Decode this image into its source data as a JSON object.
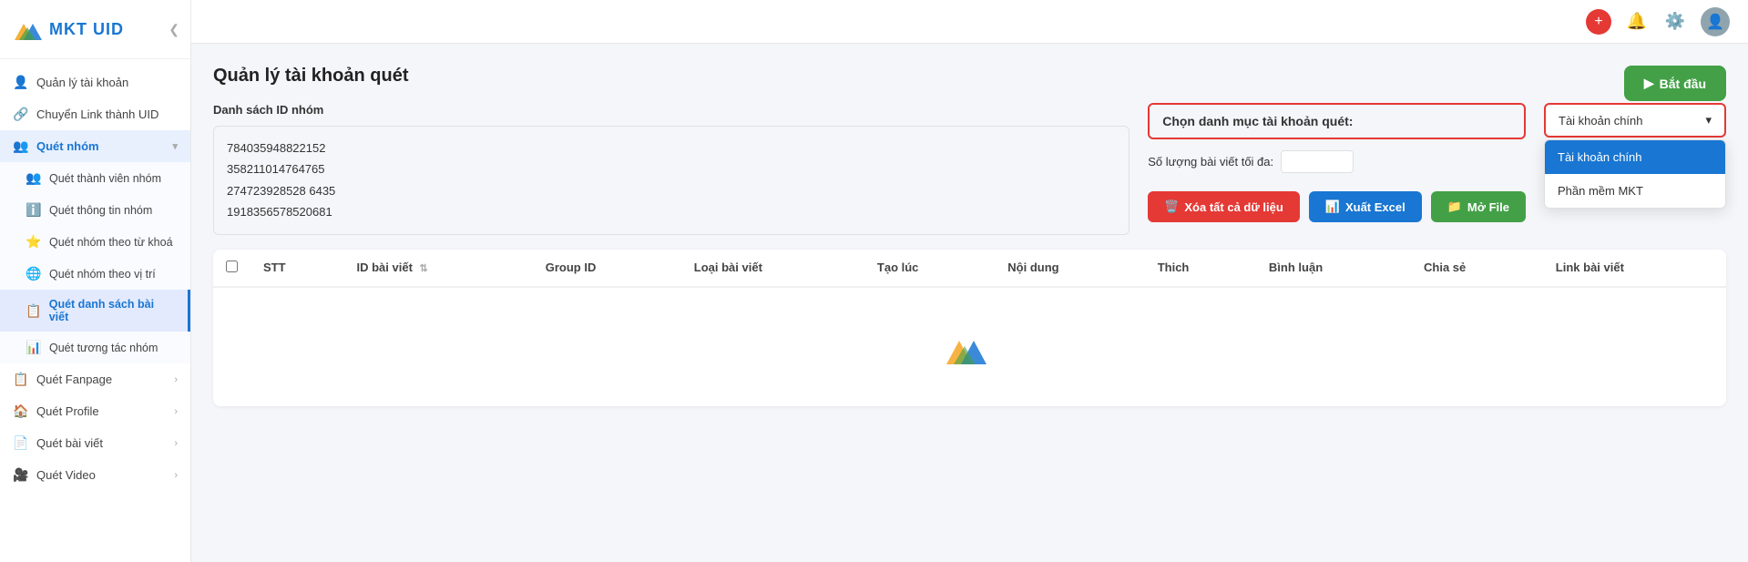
{
  "app": {
    "name": "MKT UID",
    "collapse_icon": "❮"
  },
  "sidebar": {
    "items": [
      {
        "id": "quan-ly-tai-khoan",
        "label": "Quản lý tài khoản",
        "icon": "👤",
        "hasChildren": false
      },
      {
        "id": "chuyen-link-uid",
        "label": "Chuyển Link thành UID",
        "icon": "🔗",
        "hasChildren": false
      },
      {
        "id": "quet-nhom",
        "label": "Quét nhóm",
        "icon": "👥",
        "hasChildren": true,
        "expanded": true
      },
      {
        "id": "quet-fanpage",
        "label": "Quét Fanpage",
        "icon": "📋",
        "hasChildren": true
      },
      {
        "id": "quet-profile",
        "label": "Quét Profile",
        "icon": "🏠",
        "hasChildren": true
      },
      {
        "id": "quet-bai-viet",
        "label": "Quét bài viết",
        "icon": "📄",
        "hasChildren": true
      },
      {
        "id": "quet-video",
        "label": "Quét Video",
        "icon": "🎥",
        "hasChildren": true
      }
    ],
    "sub_items": [
      {
        "id": "quet-thanh-vien-nhom",
        "label": "Quét thành viên nhóm",
        "icon": "👥"
      },
      {
        "id": "quet-thong-tin-nhom",
        "label": "Quét thông tin nhóm",
        "icon": "ℹ️"
      },
      {
        "id": "quet-nhom-tu-khoa",
        "label": "Quét nhóm theo từ khoá",
        "icon": "⭐"
      },
      {
        "id": "quet-nhom-vi-tri",
        "label": "Quét nhóm theo vị trí",
        "icon": "🌐"
      },
      {
        "id": "quet-danh-sach-bai-viet",
        "label": "Quét danh sách bài viết",
        "icon": "📋",
        "active": true
      },
      {
        "id": "quet-tuong-tac-nhom",
        "label": "Quét tương tác nhóm",
        "icon": "📊"
      }
    ]
  },
  "topbar": {
    "notification_icon": "🔔",
    "settings_icon": "⚙️",
    "avatar_icon": "👤",
    "plus_icon": "+"
  },
  "page": {
    "title": "Quản lý tài khoản quét",
    "section_label": "Danh sách ID nhóm",
    "group_ids": [
      "784035948822152",
      "358211014764765",
      "274723928528 6435",
      "1918356578520681"
    ],
    "select_label": "Chọn danh mục tài khoản quét:",
    "max_posts_label": "Số lượng bài viết tối đa:",
    "dropdown_value": "Tài khoản chính",
    "dropdown_options": [
      {
        "id": "tai-khoan-chinh",
        "label": "Tài khoản chính",
        "selected": true
      },
      {
        "id": "phan-mem-mkt",
        "label": "Phần mềm MKT",
        "selected": false
      }
    ],
    "buttons": {
      "delete_all": "Xóa tất cả dữ liệu",
      "export_excel": "Xuất Excel",
      "open_file": "Mở File",
      "start": "Bắt đầu"
    },
    "table": {
      "columns": [
        {
          "id": "stt",
          "label": "STT"
        },
        {
          "id": "id-bai-viet",
          "label": "ID bài viết",
          "sortable": true
        },
        {
          "id": "group-id",
          "label": "Group ID"
        },
        {
          "id": "loai-bai-viet",
          "label": "Loại bài viết"
        },
        {
          "id": "tao-luc",
          "label": "Tạo lúc"
        },
        {
          "id": "noi-dung",
          "label": "Nội dung"
        },
        {
          "id": "thich",
          "label": "Thich"
        },
        {
          "id": "binh-luan",
          "label": "Bình luận"
        },
        {
          "id": "chia-se",
          "label": "Chia sẻ"
        },
        {
          "id": "link-bai-viet",
          "label": "Link bài viết"
        }
      ],
      "rows": []
    }
  }
}
